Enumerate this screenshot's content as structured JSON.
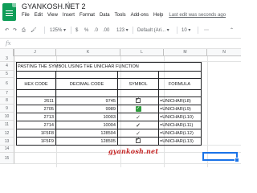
{
  "document": {
    "title": "GYANKOSH.NET 2"
  },
  "menu": {
    "items": [
      "File",
      "Edit",
      "View",
      "Insert",
      "Format",
      "Data",
      "Tools",
      "Add-ons",
      "Help"
    ],
    "last_edit": "Last edit was seconds ago"
  },
  "toolbar": {
    "zoom": "125%",
    "currency": "$",
    "percent": "%",
    "decimals_dec": ".0",
    "decimals_inc": ".00",
    "number_format": "123",
    "font": "Default (Ari...",
    "font_size": "10"
  },
  "formula_bar": {
    "fx": "fx"
  },
  "columns": [
    "J",
    "K",
    "L",
    "M",
    "N"
  ],
  "rows": [
    "3",
    "4",
    "5",
    "6",
    "7",
    "8",
    "9",
    "10",
    "11",
    "12",
    "13",
    "14",
    "15"
  ],
  "table": {
    "title": "PASTING THE SYMBOL USING THE UNICHAR FUNCTION",
    "headers": [
      "HEX CODE",
      "DECIMAL CODE",
      "SYMBOL",
      "FORMULA"
    ],
    "rows": [
      {
        "hex": "2611",
        "decimal": "9745",
        "symbol": "☑",
        "formula": "=UNICHAR(L8)"
      },
      {
        "hex": "2705",
        "decimal": "9989",
        "symbol": "✅",
        "formula": "=UNICHAR(L9)"
      },
      {
        "hex": "2713",
        "decimal": "10003",
        "symbol": "✓",
        "formula": "=UNICHAR(L10)"
      },
      {
        "hex": "2714",
        "decimal": "10004",
        "symbol": "✔",
        "formula": "=UNICHAR(L11)"
      },
      {
        "hex": "1F5F8",
        "decimal": "128504",
        "symbol": "🗸",
        "formula": "=UNICHAR(L12)"
      },
      {
        "hex": "1F5F9",
        "decimal": "128505",
        "symbol": "🗹",
        "formula": "=UNICHAR(L13)"
      }
    ]
  },
  "watermark": "gyankosh.net",
  "colors": {
    "brand_green": "#0f9d58",
    "selection_blue": "#1a73e8",
    "watermark_red": "#c62828"
  }
}
